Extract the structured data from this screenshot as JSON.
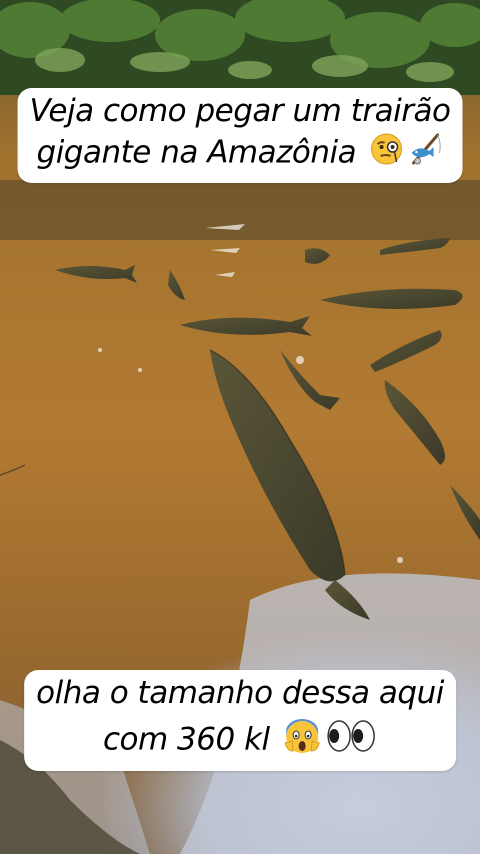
{
  "captions": {
    "top": {
      "line1": "Veja como pegar um trairão",
      "line2": "gigante na Amazônia"
    },
    "bottom": {
      "line1": "olha o tamanho dessa aqui",
      "line2": "com 360 kl"
    }
  },
  "icons": {
    "top": [
      "face-with-monocle-icon",
      "fishing-pole-icon"
    ],
    "bottom": [
      "face-screaming-in-fear-icon",
      "eyes-icon"
    ]
  },
  "colors": {
    "water": "#9a6e34",
    "caption_background": "#ffffff",
    "caption_text": "#000000"
  }
}
